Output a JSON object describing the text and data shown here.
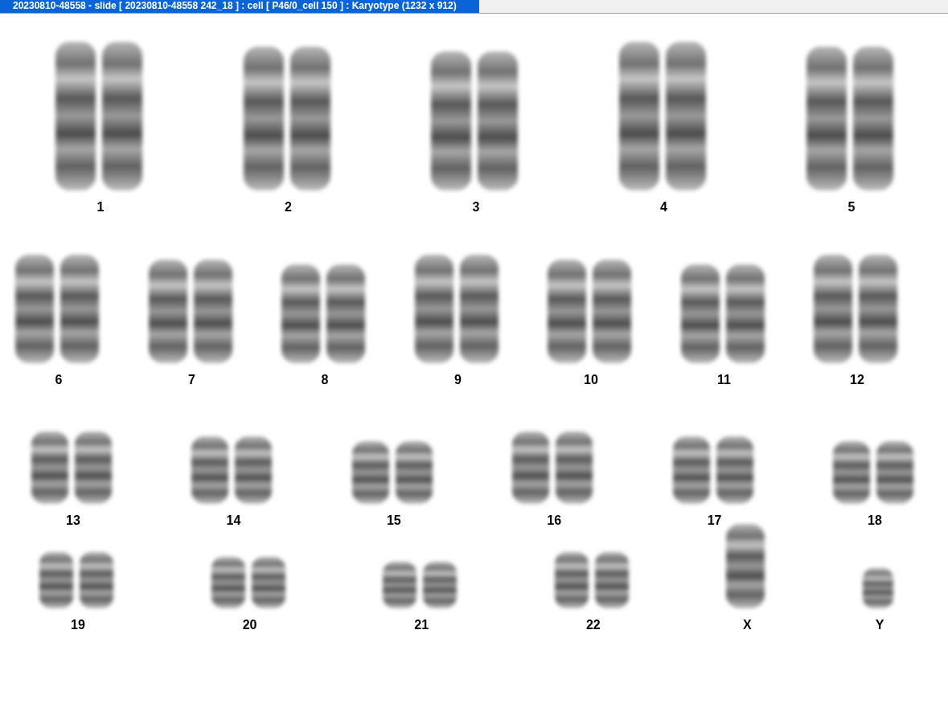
{
  "window": {
    "title": "20230810-48558 - slide [ 20230810-48558 242_18 ] : cell [ P46/0_cell 150 ] : Karyotype  (1232 x 912)"
  },
  "karyotype": {
    "rows": [
      {
        "chromosomes": [
          {
            "label": "1",
            "kind": "pair"
          },
          {
            "label": "2",
            "kind": "pair"
          },
          {
            "label": "3",
            "kind": "pair"
          },
          {
            "label": "4",
            "kind": "pair"
          },
          {
            "label": "5",
            "kind": "pair"
          }
        ]
      },
      {
        "chromosomes": [
          {
            "label": "6",
            "kind": "pair"
          },
          {
            "label": "7",
            "kind": "pair"
          },
          {
            "label": "8",
            "kind": "pair"
          },
          {
            "label": "9",
            "kind": "pair"
          },
          {
            "label": "10",
            "kind": "pair"
          },
          {
            "label": "11",
            "kind": "pair"
          },
          {
            "label": "12",
            "kind": "pair"
          }
        ]
      },
      {
        "chromosomes": [
          {
            "label": "13",
            "kind": "pair"
          },
          {
            "label": "14",
            "kind": "pair"
          },
          {
            "label": "15",
            "kind": "pair"
          },
          {
            "label": "16",
            "kind": "pair"
          },
          {
            "label": "17",
            "kind": "pair"
          },
          {
            "label": "18",
            "kind": "pair"
          }
        ]
      },
      {
        "chromosomes": [
          {
            "label": "19",
            "kind": "pair"
          },
          {
            "label": "20",
            "kind": "pair"
          },
          {
            "label": "21",
            "kind": "pair"
          },
          {
            "label": "22",
            "kind": "pair"
          },
          {
            "label": "X",
            "kind": "single"
          },
          {
            "label": "Y",
            "kind": "single"
          }
        ]
      }
    ]
  }
}
